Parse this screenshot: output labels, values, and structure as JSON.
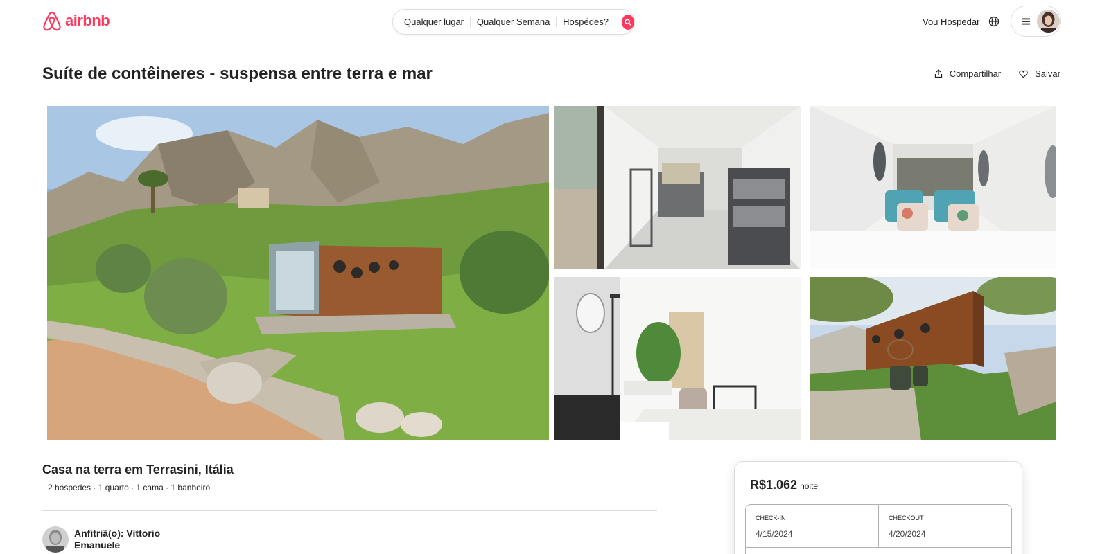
{
  "header": {
    "logo_text": "airbnb",
    "search": {
      "location": "Qualquer lugar",
      "week": "Qualquer Semana",
      "guests": "Hospédes?"
    },
    "host_link": "Vou Hospedar",
    "icons": {
      "logo": "airbnb-logo-icon",
      "search": "search-icon",
      "globe": "globe-icon",
      "menu": "hamburger-menu-icon",
      "avatar": "user-avatar"
    },
    "brand_color": "#ff385c"
  },
  "listing": {
    "title": "Suíte de contêineres - suspensa entre terra e mar",
    "share_label": "Compartilhar",
    "save_label": "Salvar",
    "gallery": [
      "exterior-hillside",
      "container-interior-kitchen",
      "container-bedroom",
      "bathroom-shower",
      "exterior-terrace"
    ],
    "subtitle": "Casa na terra em Terrasini, Itália",
    "features": "2 hóspedes · 1 quarto · 1 cama · 1 banheiro",
    "host": "Anfitriã(o): Vittorio Emanuele"
  },
  "booking": {
    "price": "R$1.062",
    "price_unit": "noite",
    "checkin_label": "CHECK-IN",
    "checkin_value": "4/15/2024",
    "checkout_label": "CHECKOUT",
    "checkout_value": "4/20/2024"
  }
}
